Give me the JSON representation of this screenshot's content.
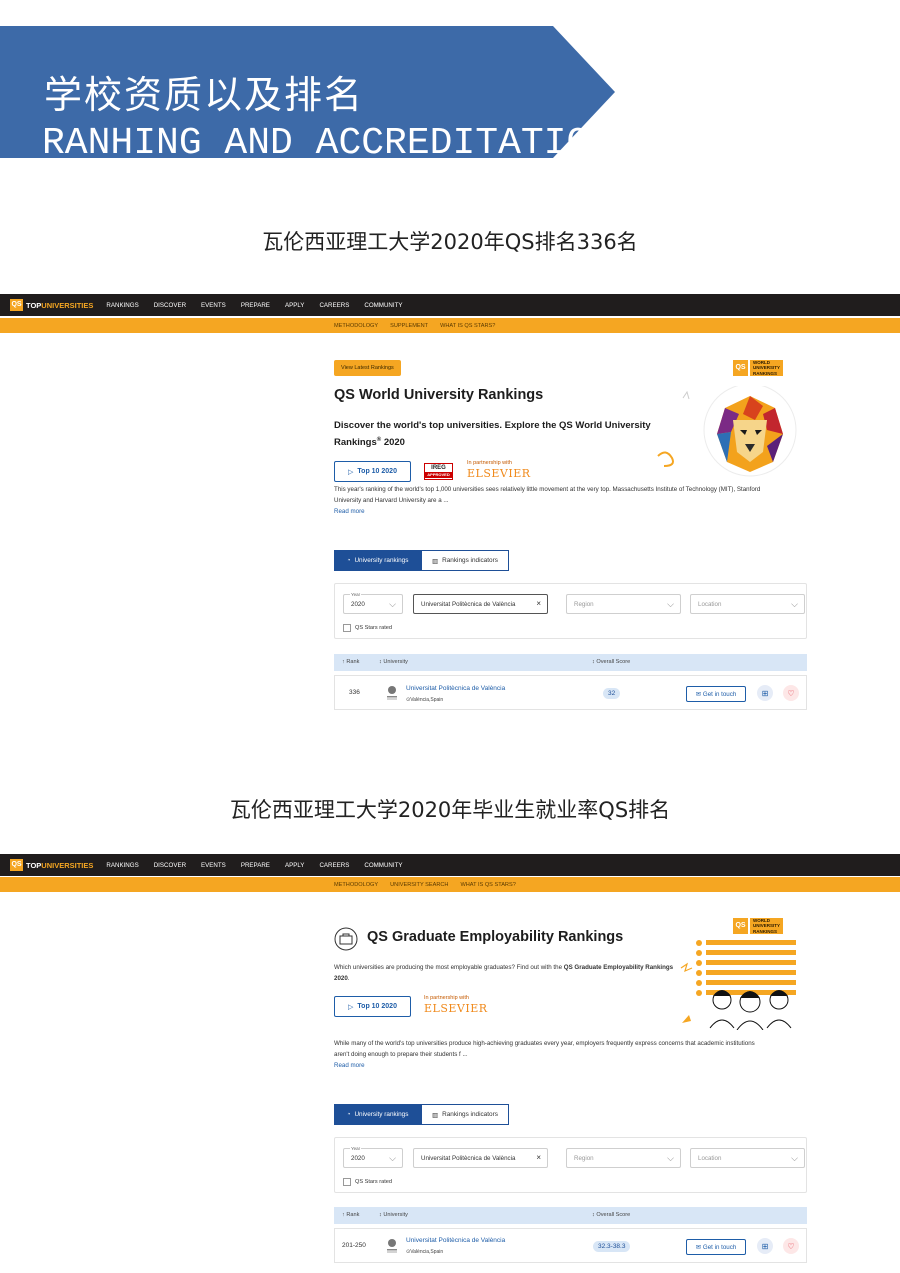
{
  "banner": {
    "title_cn": "学校资质以及排名",
    "title_en": "RANHING AND ACCREDITATION",
    "color": "#3d6aa8"
  },
  "section1": {
    "caption": "瓦伦西亚理工大学2020年QS排名336名",
    "nav": {
      "logo_box": "QS",
      "logo_top": "TOP",
      "logo_universities": "UNIVERSITIES",
      "links": [
        "RANKINGS",
        "DISCOVER",
        "EVENTS",
        "PREPARE",
        "APPLY",
        "CAREERS",
        "COMMUNITY"
      ],
      "sub_links": [
        "METHODOLOGY",
        "SUPPLEMENT",
        "WHAT IS QS STARS?"
      ]
    },
    "view_latest": "View Latest Rankings",
    "badge": {
      "qs": "QS",
      "lines": [
        "WORLD",
        "UNIVERSITY",
        "RANKINGS"
      ]
    },
    "title": "QS World University Rankings",
    "subtitle_a": "Discover the world's top universities. Explore the QS World University",
    "subtitle_b": "Rankings",
    "subtitle_sup": "®",
    "subtitle_c": " 2020",
    "top10": "Top 10 2020",
    "ireg": {
      "top": "IREG",
      "bottom": "APPROVED"
    },
    "partner_label": "In partnership with",
    "partner": "ELSEVIER",
    "paragraph_1": "This year's ranking of the world's top 1,000 universities sees relatively little movement at the very top. Massachusetts Institute of Technology (MIT), Stanford",
    "paragraph_2": "University and Harvard University are a ...",
    "read_more": "Read more",
    "tab_active": "University rankings",
    "tab_inactive": "Rankings indicators",
    "year_label": "Year",
    "year_value": "2020",
    "search_value": "Universitat Politècnica de València",
    "region_placeholder": "Region",
    "location_placeholder": "Location",
    "stars_rated": "QS Stars rated",
    "col_rank": "Rank",
    "col_university": "University",
    "col_score": "Overall Score",
    "row": {
      "rank": "336",
      "name": "Universitat Politècnica de València",
      "location": "València,Spain",
      "score": "32",
      "get_in_touch": "Get in touch"
    }
  },
  "section2": {
    "caption": "瓦伦西亚理工大学2020年毕业生就业率QS排名",
    "nav": {
      "logo_box": "QS",
      "logo_top": "TOP",
      "logo_universities": "UNIVERSITIES",
      "links": [
        "RANKINGS",
        "DISCOVER",
        "EVENTS",
        "PREPARE",
        "APPLY",
        "CAREERS",
        "COMMUNITY"
      ],
      "sub_links": [
        "METHODOLOGY",
        "UNIVERSITY SEARCH",
        "WHAT IS QS STARS?"
      ]
    },
    "badge": {
      "qs": "QS",
      "lines": [
        "WORLD",
        "UNIVERSITY",
        "RANKINGS"
      ]
    },
    "title": "QS Graduate Employability Rankings",
    "intro_1": "Which universities are producing the most employable graduates? Find out with the ",
    "intro_bold": "QS Graduate Employability",
    "intro_2": "Rankings 2020",
    "intro_3": ".",
    "top10": "Top 10 2020",
    "partner_label": "In partnership with",
    "partner": "ELSEVIER",
    "paragraph_1": "While many of the world's top universities produce high-achieving graduates every year, employers frequently express concerns that academic institutions",
    "paragraph_2": "aren't doing enough to prepare their students f ...",
    "read_more": "Read more",
    "tab_active": "University rankings",
    "tab_inactive": "Rankings indicators",
    "year_label": "Year",
    "year_value": "2020",
    "search_value": "Universitat Politècnica de València",
    "region_placeholder": "Region",
    "location_placeholder": "Location",
    "stars_rated": "QS Stars rated",
    "col_rank": "Rank",
    "col_university": "University",
    "col_score": "Overall Score",
    "row": {
      "rank": "201-250",
      "name": "Universitat Politècnica de València",
      "location": "València,Spain",
      "score": "32.3-38.3",
      "get_in_touch": "Get in touch"
    }
  }
}
